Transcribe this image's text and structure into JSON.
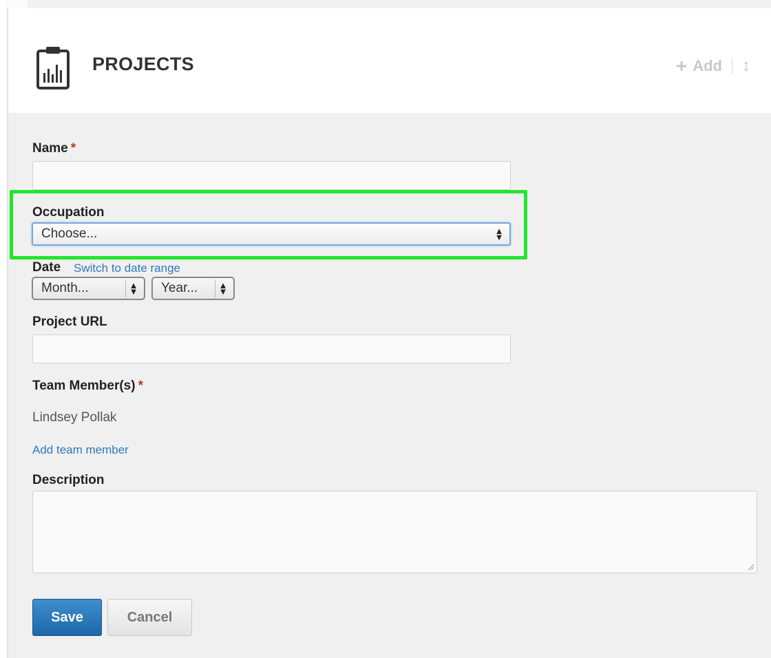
{
  "header": {
    "title": "PROJECTS",
    "add_label": "Add"
  },
  "form": {
    "name": {
      "label": "Name",
      "required_mark": "*",
      "value": ""
    },
    "occupation": {
      "label": "Occupation",
      "selected": "Choose..."
    },
    "date": {
      "label": "Date",
      "switch_link": "Switch to date range",
      "month_selected": "Month...",
      "year_selected": "Year..."
    },
    "project_url": {
      "label": "Project URL",
      "value": ""
    },
    "team_members": {
      "label": "Team Member(s)",
      "required_mark": "*",
      "members": [
        "Lindsey Pollak"
      ],
      "add_link": "Add team member"
    },
    "description": {
      "label": "Description",
      "value": ""
    }
  },
  "buttons": {
    "save": "Save",
    "cancel": "Cancel"
  },
  "colors": {
    "primary": "#2a78bd",
    "link": "#2f79bd",
    "required": "#c0392b",
    "highlight": "#22e62a"
  }
}
